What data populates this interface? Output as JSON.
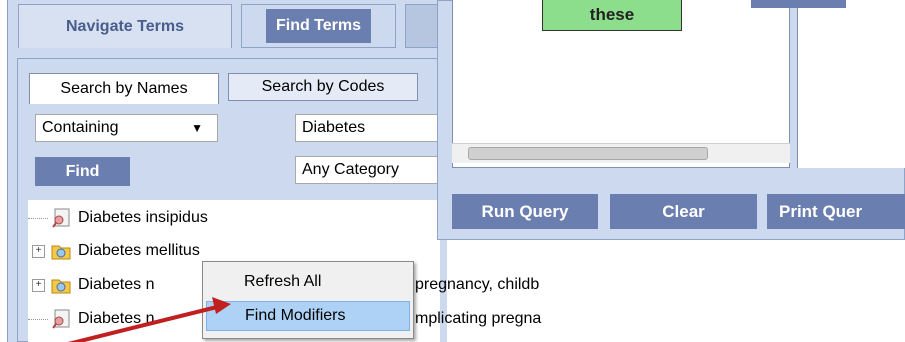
{
  "main_tabs": {
    "navigate": "Navigate Terms",
    "find": "Find Terms"
  },
  "sub_tabs": {
    "names": "Search by Names",
    "codes": "Search by Codes"
  },
  "search": {
    "match_mode": "Containing",
    "term": "Diabetes",
    "category": "Any Category",
    "find_label": "Find"
  },
  "tree": [
    {
      "label": "Diabetes insipidus",
      "type": "leaf"
    },
    {
      "label": "Diabetes mellitus",
      "type": "folder"
    },
    {
      "label": "Diabetes n",
      "suffix": "pregnancy, childb",
      "type": "folder"
    },
    {
      "label": "Diabetes n",
      "suffix": "mplicating pregna",
      "type": "leaf"
    }
  ],
  "query": {
    "group_text": "these",
    "run_label": "Run Query",
    "clear_label": "Clear",
    "print_label": "Print Quer"
  },
  "context_menu": {
    "items": [
      "Refresh All",
      "Find Modifiers"
    ],
    "highlighted": "Find Modifiers"
  },
  "colors": {
    "panel_bg": "#ccd9ef",
    "button_bg": "#6b7eb0",
    "group_green": "#8cdd8c",
    "annotation_arrow": "#c0201f"
  },
  "icons": {
    "leaf": "term-doc-icon",
    "folder": "folder-term-icon",
    "expander": "plus-expander-icon"
  }
}
